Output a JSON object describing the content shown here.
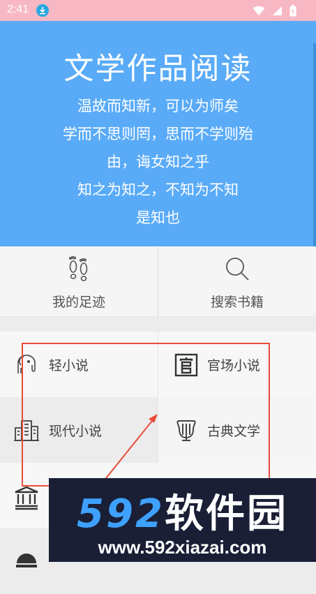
{
  "status": {
    "time": "2:41"
  },
  "header": {
    "title": "文学作品阅读",
    "poem": [
      "温故而知新，可以为师矣",
      "学而不思则罔，思而不学则殆",
      "由，诲女知之乎",
      "知之为知之，不知为不知",
      "是知也"
    ]
  },
  "quick": [
    {
      "label": "我的足迹",
      "icon": "footprints-icon"
    },
    {
      "label": "搜索书籍",
      "icon": "search-icon"
    }
  ],
  "categories": [
    {
      "label": "轻小说",
      "icon": "elephant-icon"
    },
    {
      "label": "官场小说",
      "icon": "official-icon"
    },
    {
      "label": "现代小说",
      "icon": "building-icon"
    },
    {
      "label": "古典文学",
      "icon": "lyre-icon"
    }
  ],
  "watermark": {
    "brand_num": "592",
    "brand_cn": "软件园",
    "url": "www.592xiazai.com"
  },
  "colors": {
    "header": "#5aabf7",
    "status_bar": "#f7b8c4",
    "annotation": "#e84b3a"
  }
}
